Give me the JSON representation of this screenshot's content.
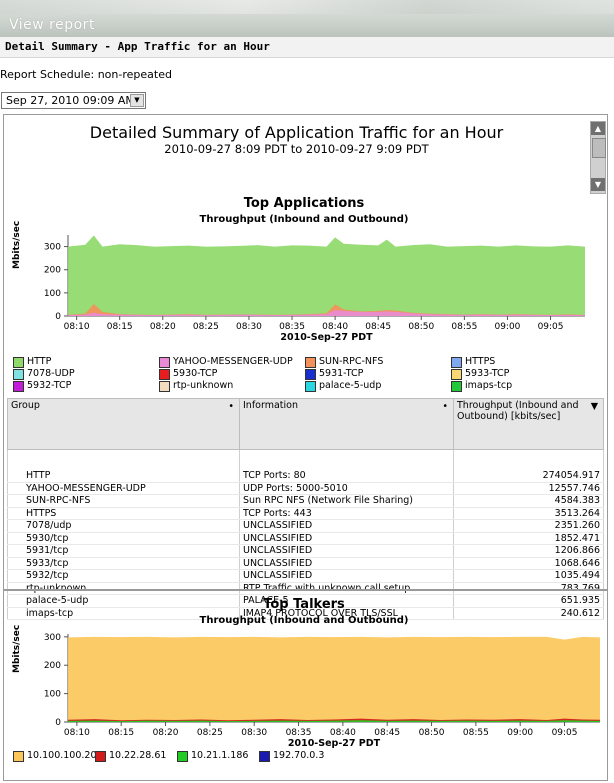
{
  "window": {
    "title": "View report"
  },
  "subtitle_bar": "Detail Summary - App Traffic for an Hour",
  "schedule": "Report Schedule: non-repeated",
  "date_select": {
    "value": "Sep 27, 2010 09:09 AM"
  },
  "report": {
    "title": "Detailed Summary of Application Traffic for an Hour",
    "range": "2010-09-27 8:09 PDT to 2010-09-27 9:09 PDT"
  },
  "colors": {
    "HTTP": "#8fd96a",
    "YAHOO-MESSENGER-UDP": "#e98ad6",
    "SUN-RPC-NFS": "#f4905a",
    "HTTPS": "#7fa8f0",
    "7078-UDP": "#7fe2e0",
    "5930-TCP": "#e81e1e",
    "5931-TCP": "#1a2fd0",
    "5933-TCP": "#f8d774",
    "5932-TCP": "#c21ed6",
    "rtp-unknown": "#f2dcc0",
    "palace-5-udp": "#2ad6e0",
    "imaps-tcp": "#21c93a",
    "talker1": "#fbc75a",
    "talker2": "#d11a1a",
    "talker3": "#22cc22",
    "talker4": "#1a1ab0"
  },
  "chart_data": [
    {
      "type": "area",
      "title": "Top Applications",
      "subtitle": "Throughput (Inbound and Outbound)",
      "ylabel": "Mbits/sec",
      "xlabel": "2010-Sep-27 PDT",
      "ylim": [
        0,
        350
      ],
      "yticks": [
        "0",
        "100",
        "200",
        "300"
      ],
      "xticks": [
        "08:10",
        "08:15",
        "08:20",
        "08:25",
        "08:30",
        "08:35",
        "08:40",
        "08:45",
        "08:50",
        "08:55",
        "09:00",
        "09:05"
      ],
      "x": [
        "08:09",
        "08:11",
        "08:12",
        "08:13",
        "08:15",
        "08:17",
        "08:19",
        "08:21",
        "08:23",
        "08:25",
        "08:27",
        "08:29",
        "08:31",
        "08:33",
        "08:35",
        "08:37",
        "08:39",
        "08:40",
        "08:41",
        "08:43",
        "08:45",
        "08:46",
        "08:47",
        "08:49",
        "08:51",
        "08:53",
        "08:55",
        "08:57",
        "08:59",
        "09:01",
        "09:03",
        "09:05",
        "09:07",
        "09:09"
      ],
      "series": [
        {
          "name": "HTTP",
          "values": [
            300,
            308,
            348,
            300,
            310,
            306,
            300,
            302,
            304,
            300,
            301,
            303,
            306,
            300,
            305,
            304,
            300,
            340,
            312,
            308,
            305,
            330,
            300,
            306,
            310,
            300,
            302,
            304,
            300,
            305,
            301,
            300,
            305,
            300
          ]
        },
        {
          "name": "SUN-RPC-NFS",
          "values": [
            5,
            10,
            52,
            18,
            8,
            6,
            5,
            6,
            8,
            5,
            6,
            7,
            6,
            5,
            6,
            8,
            12,
            50,
            28,
            20,
            22,
            26,
            24,
            14,
            10,
            8,
            6,
            8,
            6,
            8,
            6,
            5,
            7,
            5
          ]
        },
        {
          "name": "YAHOO-MESSENGER-UDP",
          "values": [
            4,
            6,
            14,
            8,
            6,
            5,
            4,
            5,
            6,
            4,
            5,
            6,
            5,
            4,
            5,
            6,
            8,
            26,
            22,
            18,
            18,
            20,
            18,
            12,
            8,
            6,
            5,
            6,
            5,
            6,
            5,
            4,
            5,
            4
          ]
        }
      ],
      "legend": [
        "HTTP",
        "YAHOO-MESSENGER-UDP",
        "SUN-RPC-NFS",
        "HTTPS",
        "7078-UDP",
        "5930-TCP",
        "5931-TCP",
        "5933-TCP",
        "5932-TCP",
        "rtp-unknown",
        "palace-5-udp",
        "imaps-tcp"
      ]
    },
    {
      "type": "area",
      "title": "Top Talkers",
      "subtitle": "Throughput (Inbound and Outbound)",
      "ylabel": "Mbits/sec",
      "xlabel": "2010-Sep-27 PDT",
      "ylim": [
        0,
        310
      ],
      "yticks": [
        "0",
        "100",
        "200",
        "300"
      ],
      "xticks": [
        "08:10",
        "08:15",
        "08:20",
        "08:25",
        "08:30",
        "08:35",
        "08:40",
        "08:45",
        "08:50",
        "08:55",
        "09:00",
        "09:05"
      ],
      "x": [
        "08:09",
        "08:12",
        "08:15",
        "08:18",
        "08:21",
        "08:24",
        "08:27",
        "08:30",
        "08:33",
        "08:36",
        "08:39",
        "08:42",
        "08:45",
        "08:48",
        "08:51",
        "08:54",
        "08:57",
        "09:00",
        "09:03",
        "09:05",
        "09:07",
        "09:09"
      ],
      "series": [
        {
          "name": "10.100.100.20",
          "values": [
            298,
            300,
            299,
            300,
            298,
            300,
            299,
            300,
            298,
            300,
            299,
            300,
            298,
            300,
            299,
            300,
            299,
            300,
            300,
            290,
            300,
            298
          ]
        },
        {
          "name": "10.22.28.61",
          "values": [
            8,
            10,
            6,
            8,
            7,
            9,
            6,
            8,
            10,
            7,
            9,
            12,
            8,
            10,
            7,
            9,
            8,
            10,
            7,
            12,
            9,
            8
          ]
        },
        {
          "name": "10.21.1.186",
          "values": [
            4,
            5,
            3,
            5,
            4,
            5,
            3,
            4,
            5,
            4,
            5,
            6,
            4,
            5,
            4,
            5,
            4,
            5,
            4,
            6,
            5,
            4
          ]
        }
      ],
      "legend": [
        "10.100.100.20",
        "10.22.28.61",
        "10.21.1.186",
        "192.70.0.3"
      ]
    }
  ],
  "table": {
    "headers": [
      "Group",
      "Information",
      "Throughput (Inbound and Outbound) [kbits/sec]"
    ],
    "rows": [
      [
        "HTTP",
        "TCP Ports: 80",
        "274054.917"
      ],
      [
        "YAHOO-MESSENGER-UDP",
        "UDP Ports: 5000-5010",
        "12557.746"
      ],
      [
        "SUN-RPC-NFS",
        "Sun RPC NFS (Network File Sharing)",
        "4584.383"
      ],
      [
        "HTTPS",
        "TCP Ports: 443",
        "3513.264"
      ],
      [
        "7078/udp",
        "UNCLASSIFIED",
        "2351.260"
      ],
      [
        "5930/tcp",
        "UNCLASSIFIED",
        "1852.471"
      ],
      [
        "5931/tcp",
        "UNCLASSIFIED",
        "1206.866"
      ],
      [
        "5933/tcp",
        "UNCLASSIFIED",
        "1068.646"
      ],
      [
        "5932/tcp",
        "UNCLASSIFIED",
        "1035.494"
      ],
      [
        "rtp-unknown",
        "RTP Traffic with unknown call setup",
        "783.769"
      ],
      [
        "palace-5-udp",
        "PALACE-5",
        "651.935"
      ],
      [
        "imaps-tcp",
        "IMAP4 PROTOCOL OVER TLS/SSL",
        "240.612"
      ]
    ]
  }
}
